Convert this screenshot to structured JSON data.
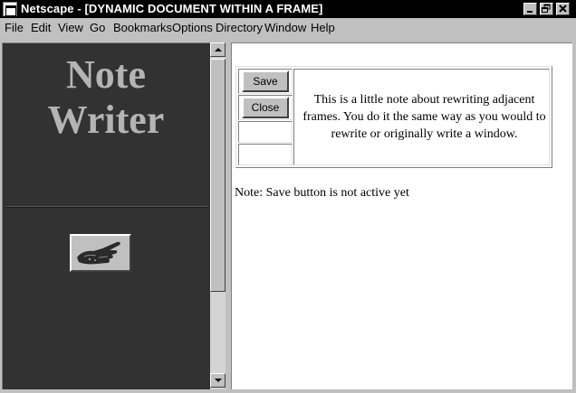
{
  "window": {
    "title": "Netscape - [DYNAMIC DOCUMENT WITHIN A FRAME]",
    "minimize_icon": "minimize-icon",
    "restore_icon": "restore-icon",
    "close_icon": "close-icon"
  },
  "menu": {
    "items": [
      "File",
      "Edit",
      "View",
      "Go",
      "Bookmarks",
      "Options",
      "Directory",
      "Window",
      "Help"
    ]
  },
  "left_frame": {
    "title_line1": "Note",
    "title_line2": "Writer",
    "hand_icon": "pointing-hand-icon"
  },
  "right_frame": {
    "save_label": "Save",
    "close_label": "Close",
    "note_text": "This is a little note about rewriting adjacent frames. You do it the same way as you would to rewrite or originally write a window.",
    "status_note": "Note: Save button is not active yet"
  },
  "colors": {
    "left_frame_bg": "#323232",
    "title_text": "#b4b4b4",
    "titlebar_bg": "#000000",
    "chrome": "#c0c0c0"
  }
}
